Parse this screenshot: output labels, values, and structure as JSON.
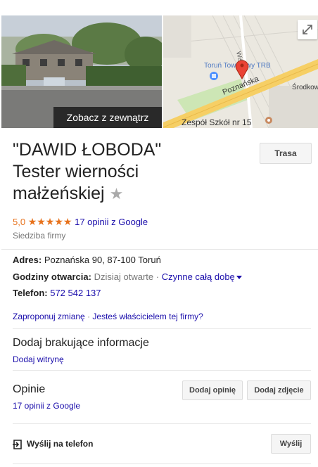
{
  "media": {
    "street_view_label": "Zobacz z zewnątrz",
    "map_labels": {
      "street_wislana": "Wiślana",
      "station": "Toruń Towarowy TRB",
      "street_poznanska": "Poznańska",
      "street_srodkowa": "Środkowa",
      "school": "Zespół Szkół nr 15"
    }
  },
  "header": {
    "title_line1": "\"DAWID ŁOBODA\"",
    "title_line2": "Tester wierności",
    "title_line3": "małżeńskiej",
    "route_button": "Trasa"
  },
  "rating": {
    "value": "5,0",
    "stars": "★★★★★",
    "reviews_link": "17 opinii z Google"
  },
  "category": "Siedziba firmy",
  "details": {
    "address_label": "Adres:",
    "address_value": "Poznańska 90, 87-100 Toruń",
    "hours_label": "Godziny otwarcia:",
    "hours_today": "Dzisiaj otwarte",
    "hours_sep": "·",
    "hours_value": "Czynne całą dobę",
    "phone_label": "Telefon:",
    "phone_value": "572 542 137"
  },
  "suggest": {
    "edit_link": "Zaproponuj zmianę",
    "sep": "·",
    "owner_link": "Jesteś właścicielem tej firmy?"
  },
  "missing_info": {
    "title": "Dodaj brakujące informacje",
    "add_website": "Dodaj witrynę"
  },
  "reviews": {
    "title": "Opinie",
    "count_link": "17 opinii z Google",
    "add_review_button": "Dodaj opinię",
    "add_photo_button": "Dodaj zdjęcie"
  },
  "send": {
    "label": "Wyślij na telefon",
    "button": "Wyślij"
  },
  "colors": {
    "link": "#1a0dab",
    "star": "#e7711b",
    "map_pin": "#ea4335",
    "map_road": "#f6cf65"
  }
}
